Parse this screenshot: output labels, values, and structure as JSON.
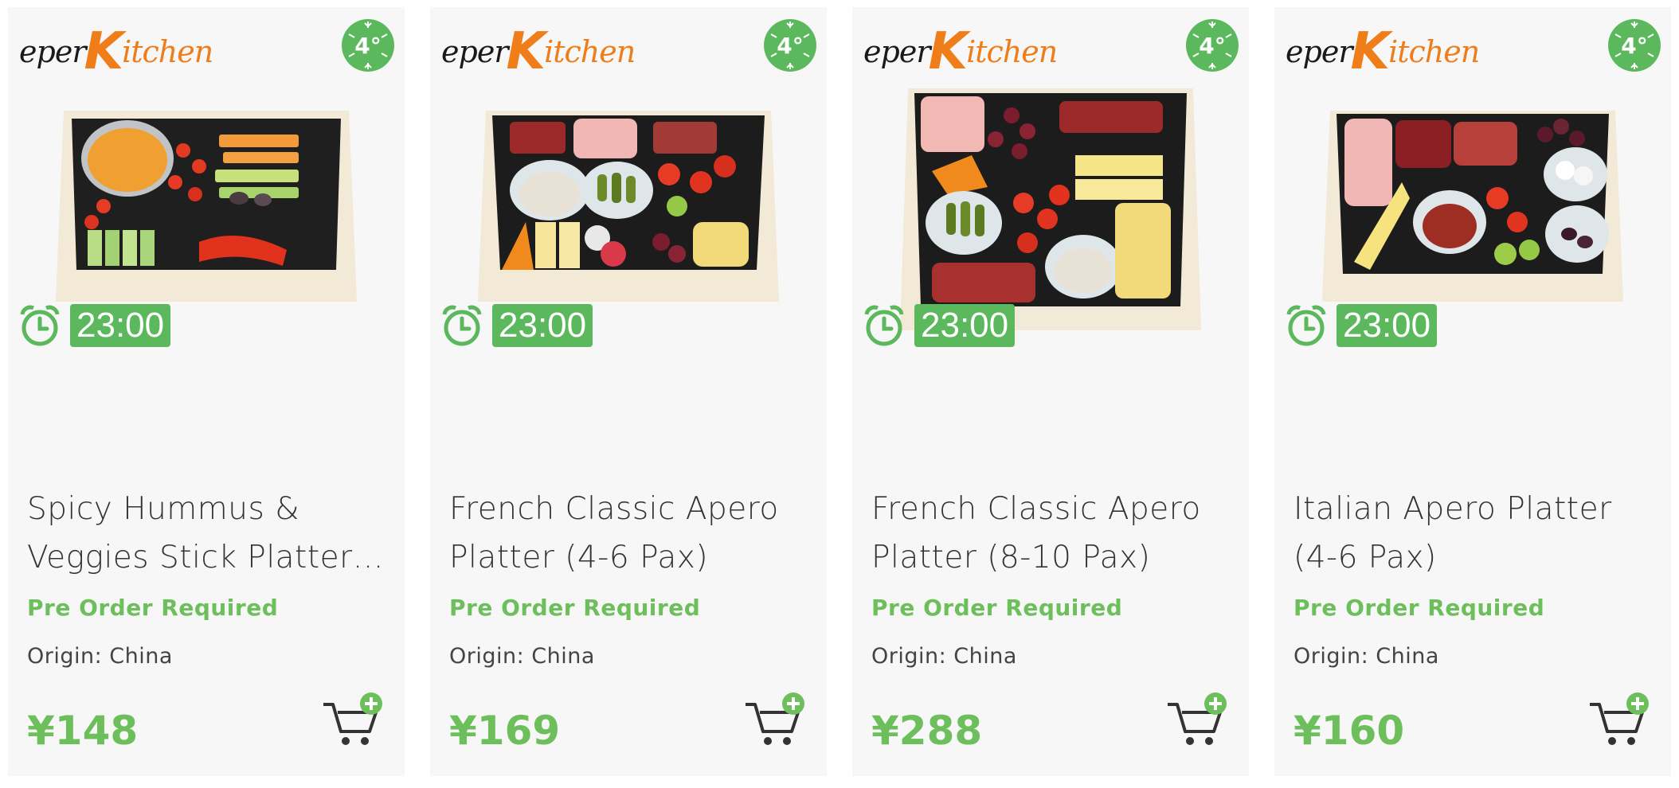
{
  "brand": {
    "logo_prefix": "e",
    "logo_mid": "per",
    "logo_k": "K",
    "logo_suffix": "itchen",
    "logo_orange": "#ef7d1a"
  },
  "temperature_badge": "4°",
  "accent_green": "#6cbf5b",
  "products": [
    {
      "title": "Spicy Hummus & Veggies Stick Platter…",
      "timer": "23:00",
      "status": "Pre Order Required",
      "origin": "Origin: China",
      "price": "¥148",
      "image_kind": "veggie-hummus-platter"
    },
    {
      "title": "French Classic Apero Platter (4-6 Pax)",
      "timer": "23:00",
      "status": "Pre Order Required",
      "origin": "Origin: China",
      "price": "¥169",
      "image_kind": "french-apero-platter"
    },
    {
      "title": "French Classic Apero Platter (8-10 Pax)",
      "timer": "23:00",
      "status": "Pre Order Required",
      "origin": "Origin: China",
      "price": "¥288",
      "image_kind": "french-apero-platter-large"
    },
    {
      "title": "Italian Apero Platter (4-6 Pax)",
      "timer": "23:00",
      "status": "Pre Order Required",
      "origin": "Origin: China",
      "price": "¥160",
      "image_kind": "italian-apero-platter"
    }
  ]
}
